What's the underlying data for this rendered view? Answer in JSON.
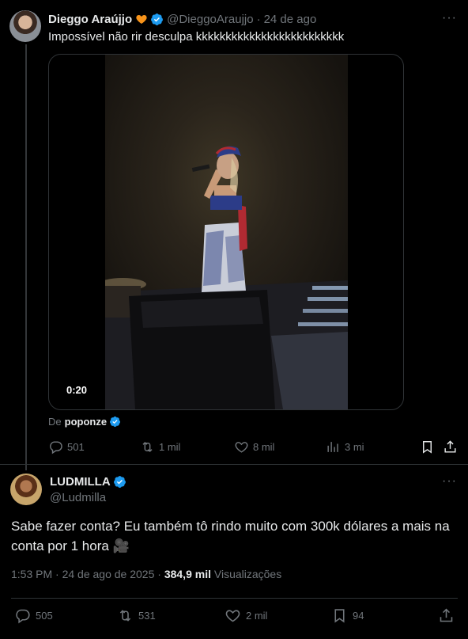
{
  "parent_tweet": {
    "author_name": "Dieggo Araújjo",
    "handle": "@DieggoAraujjo",
    "separator": "·",
    "date": "24 de ago",
    "text": "Impossível não rir desculpa kkkkkkkkkkkkkkkkkkkkkkkkk",
    "video_duration": "0:20",
    "from_prefix": "De",
    "from_user": "poponze",
    "stats": {
      "replies": "501",
      "reposts": "1 mil",
      "likes": "8 mil",
      "views": "3 mi"
    },
    "more_label": "···"
  },
  "main_tweet": {
    "author_name": "LUDMILLA",
    "handle": "@Ludmilla",
    "text": "Sabe fazer conta? Eu também tô rindo muito com 300k dólares a mais na conta por 1 hora 🎥",
    "time": "1:53 PM",
    "separator": "·",
    "date": "24 de ago de 2025",
    "separator2": "·",
    "views_count": "384,9 mil",
    "views_label": "Visualizações",
    "stats": {
      "replies": "505",
      "reposts": "531",
      "likes": "2 mil",
      "bookmarks": "94"
    },
    "more_label": "···"
  },
  "colors": {
    "background": "#000000",
    "text": "#e7e9ea",
    "muted": "#71767b",
    "verified": "#1d9bf0",
    "heart": "#f7931a",
    "border": "#2f3336"
  },
  "icons": [
    "verified-badge-icon",
    "orange-heart-icon",
    "reply-icon",
    "repost-icon",
    "like-icon",
    "views-icon",
    "bookmark-icon",
    "share-icon",
    "more-icon"
  ]
}
